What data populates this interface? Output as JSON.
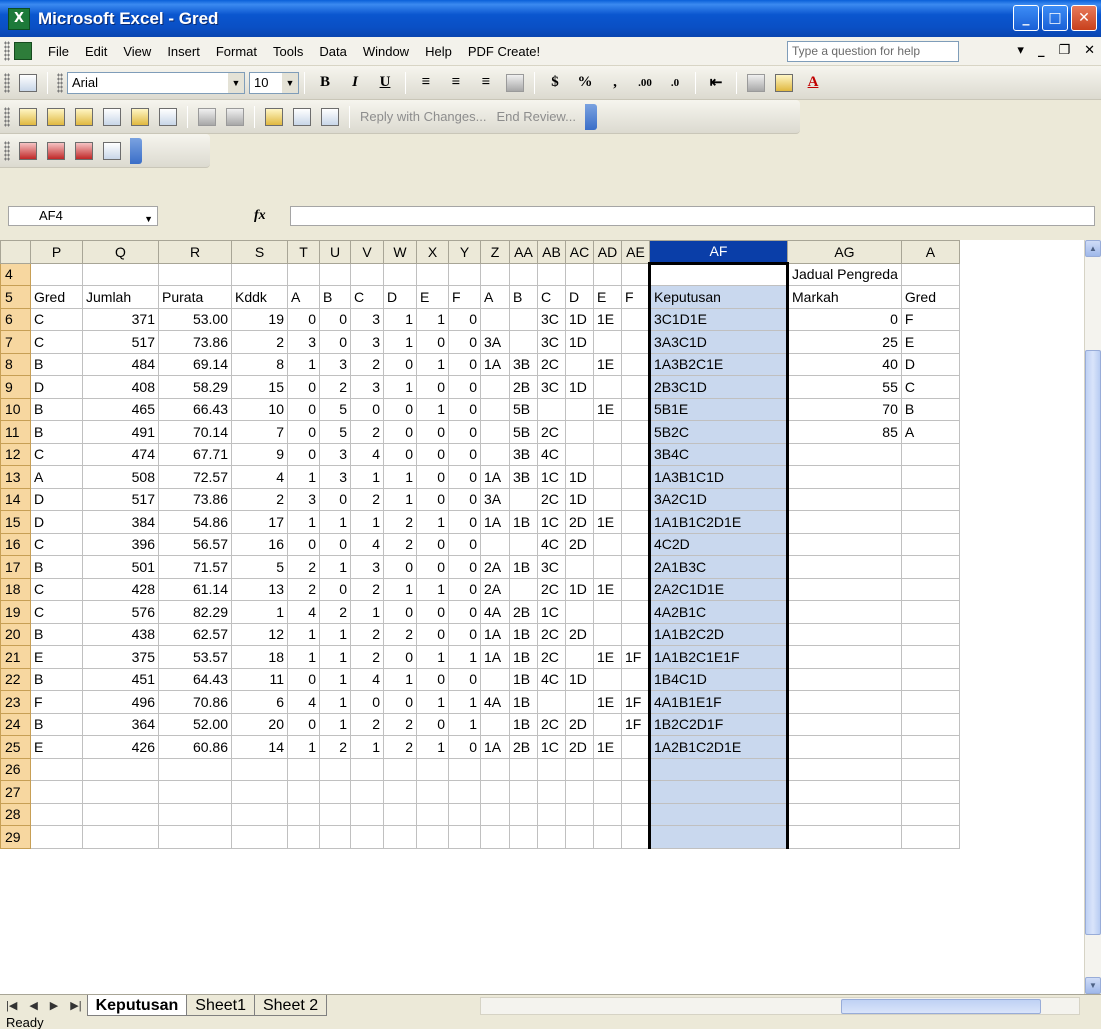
{
  "window": {
    "title": "Microsoft Excel - Gred",
    "app_icon": "X"
  },
  "menu": {
    "items": [
      "File",
      "Edit",
      "View",
      "Insert",
      "Format",
      "Tools",
      "Data",
      "Window",
      "Help",
      "PDF Create!"
    ],
    "help_placeholder": "Type a question for help"
  },
  "format_toolbar": {
    "font": "Arial",
    "size": "10",
    "bold": "B",
    "italic": "I",
    "underline": "U",
    "currency": "$",
    "percent": "%",
    "comma": ",",
    "font_color_letter": "A"
  },
  "review_toolbar": {
    "reply_label": "Reply with Changes...",
    "end_review_label": "End Review..."
  },
  "formula_bar": {
    "name_box": "AF4",
    "fx": "fx",
    "formula": ""
  },
  "grid": {
    "columns": [
      "P",
      "Q",
      "R",
      "S",
      "T",
      "U",
      "V",
      "W",
      "X",
      "Y",
      "Z",
      "AA",
      "AB",
      "AC",
      "AD",
      "AE",
      "AF",
      "AG",
      "A"
    ],
    "selected_column": "AF",
    "active_cell": "AF4",
    "rows": [
      {
        "n": "4",
        "c": [
          "",
          "",
          "",
          "",
          "",
          "",
          "",
          "",
          "",
          "",
          "",
          "",
          "",
          "",
          "",
          "",
          "",
          "Jadual Pengreda",
          ""
        ]
      },
      {
        "n": "5",
        "c": [
          "Gred",
          "Jumlah",
          "Purata",
          "Kddk",
          "A",
          "B",
          "C",
          "D",
          "E",
          "F",
          "A",
          "B",
          "C",
          "D",
          "E",
          "F",
          "Keputusan",
          "Markah",
          "Gred"
        ]
      },
      {
        "n": "6",
        "c": [
          "C",
          "371",
          "53.00",
          "19",
          "0",
          "0",
          "3",
          "1",
          "1",
          "0",
          "",
          "",
          "3C",
          "1D",
          "1E",
          "",
          "3C1D1E",
          "0",
          "F"
        ]
      },
      {
        "n": "7",
        "c": [
          "C",
          "517",
          "73.86",
          "2",
          "3",
          "0",
          "3",
          "1",
          "0",
          "0",
          "3A",
          "",
          "3C",
          "1D",
          "",
          "",
          "3A3C1D",
          "25",
          "E"
        ]
      },
      {
        "n": "8",
        "c": [
          "B",
          "484",
          "69.14",
          "8",
          "1",
          "3",
          "2",
          "0",
          "1",
          "0",
          "1A",
          "3B",
          "2C",
          "",
          "1E",
          "",
          "1A3B2C1E",
          "40",
          "D"
        ]
      },
      {
        "n": "9",
        "c": [
          "D",
          "408",
          "58.29",
          "15",
          "0",
          "2",
          "3",
          "1",
          "0",
          "0",
          "",
          "2B",
          "3C",
          "1D",
          "",
          "",
          "2B3C1D",
          "55",
          "C"
        ]
      },
      {
        "n": "10",
        "c": [
          "B",
          "465",
          "66.43",
          "10",
          "0",
          "5",
          "0",
          "0",
          "1",
          "0",
          "",
          "5B",
          "",
          "",
          "1E",
          "",
          "5B1E",
          "70",
          "B"
        ]
      },
      {
        "n": "11",
        "c": [
          "B",
          "491",
          "70.14",
          "7",
          "0",
          "5",
          "2",
          "0",
          "0",
          "0",
          "",
          "5B",
          "2C",
          "",
          "",
          "",
          "5B2C",
          "85",
          "A"
        ]
      },
      {
        "n": "12",
        "c": [
          "C",
          "474",
          "67.71",
          "9",
          "0",
          "3",
          "4",
          "0",
          "0",
          "0",
          "",
          "3B",
          "4C",
          "",
          "",
          "",
          "3B4C",
          "",
          ""
        ]
      },
      {
        "n": "13",
        "c": [
          "A",
          "508",
          "72.57",
          "4",
          "1",
          "3",
          "1",
          "1",
          "0",
          "0",
          "1A",
          "3B",
          "1C",
          "1D",
          "",
          "",
          "1A3B1C1D",
          "",
          ""
        ]
      },
      {
        "n": "14",
        "c": [
          "D",
          "517",
          "73.86",
          "2",
          "3",
          "0",
          "2",
          "1",
          "0",
          "0",
          "3A",
          "",
          "2C",
          "1D",
          "",
          "",
          "3A2C1D",
          "",
          ""
        ]
      },
      {
        "n": "15",
        "c": [
          "D",
          "384",
          "54.86",
          "17",
          "1",
          "1",
          "1",
          "2",
          "1",
          "0",
          "1A",
          "1B",
          "1C",
          "2D",
          "1E",
          "",
          "1A1B1C2D1E",
          "",
          ""
        ]
      },
      {
        "n": "16",
        "c": [
          "C",
          "396",
          "56.57",
          "16",
          "0",
          "0",
          "4",
          "2",
          "0",
          "0",
          "",
          "",
          "4C",
          "2D",
          "",
          "",
          "4C2D",
          "",
          ""
        ]
      },
      {
        "n": "17",
        "c": [
          "B",
          "501",
          "71.57",
          "5",
          "2",
          "1",
          "3",
          "0",
          "0",
          "0",
          "2A",
          "1B",
          "3C",
          "",
          "",
          "",
          "2A1B3C",
          "",
          ""
        ]
      },
      {
        "n": "18",
        "c": [
          "C",
          "428",
          "61.14",
          "13",
          "2",
          "0",
          "2",
          "1",
          "1",
          "0",
          "2A",
          "",
          "2C",
          "1D",
          "1E",
          "",
          "2A2C1D1E",
          "",
          ""
        ]
      },
      {
        "n": "19",
        "c": [
          "C",
          "576",
          "82.29",
          "1",
          "4",
          "2",
          "1",
          "0",
          "0",
          "0",
          "4A",
          "2B",
          "1C",
          "",
          "",
          "",
          "4A2B1C",
          "",
          ""
        ]
      },
      {
        "n": "20",
        "c": [
          "B",
          "438",
          "62.57",
          "12",
          "1",
          "1",
          "2",
          "2",
          "0",
          "0",
          "1A",
          "1B",
          "2C",
          "2D",
          "",
          "",
          "1A1B2C2D",
          "",
          ""
        ]
      },
      {
        "n": "21",
        "c": [
          "E",
          "375",
          "53.57",
          "18",
          "1",
          "1",
          "2",
          "0",
          "1",
          "1",
          "1A",
          "1B",
          "2C",
          "",
          "1E",
          "1F",
          "1A1B2C1E1F",
          "",
          ""
        ]
      },
      {
        "n": "22",
        "c": [
          "B",
          "451",
          "64.43",
          "11",
          "0",
          "1",
          "4",
          "1",
          "0",
          "0",
          "",
          "1B",
          "4C",
          "1D",
          "",
          "",
          "1B4C1D",
          "",
          ""
        ]
      },
      {
        "n": "23",
        "c": [
          "F",
          "496",
          "70.86",
          "6",
          "4",
          "1",
          "0",
          "0",
          "1",
          "1",
          "4A",
          "1B",
          "",
          "",
          "1E",
          "1F",
          "4A1B1E1F",
          "",
          ""
        ]
      },
      {
        "n": "24",
        "c": [
          "B",
          "364",
          "52.00",
          "20",
          "0",
          "1",
          "2",
          "2",
          "0",
          "1",
          "",
          "1B",
          "2C",
          "2D",
          "",
          "1F",
          "1B2C2D1F",
          "",
          ""
        ]
      },
      {
        "n": "25",
        "c": [
          "E",
          "426",
          "60.86",
          "14",
          "1",
          "2",
          "1",
          "2",
          "1",
          "0",
          "1A",
          "2B",
          "1C",
          "2D",
          "1E",
          "",
          "1A2B1C2D1E",
          "",
          ""
        ]
      },
      {
        "n": "26",
        "c": [
          "",
          "",
          "",
          "",
          "",
          "",
          "",
          "",
          "",
          "",
          "",
          "",
          "",
          "",
          "",
          "",
          "",
          "",
          ""
        ]
      },
      {
        "n": "27",
        "c": [
          "",
          "",
          "",
          "",
          "",
          "",
          "",
          "",
          "",
          "",
          "",
          "",
          "",
          "",
          "",
          "",
          "",
          "",
          ""
        ]
      },
      {
        "n": "28",
        "c": [
          "",
          "",
          "",
          "",
          "",
          "",
          "",
          "",
          "",
          "",
          "",
          "",
          "",
          "",
          "",
          "",
          "",
          "",
          ""
        ]
      },
      {
        "n": "29",
        "c": [
          "",
          "",
          "",
          "",
          "",
          "",
          "",
          "",
          "",
          "",
          "",
          "",
          "",
          "",
          "",
          "",
          "",
          "",
          ""
        ]
      }
    ]
  },
  "sheets": {
    "tabs": [
      "Keputusan",
      "Sheet1",
      "Sheet 2"
    ],
    "active": "Keputusan"
  },
  "status": {
    "text": "Ready"
  }
}
